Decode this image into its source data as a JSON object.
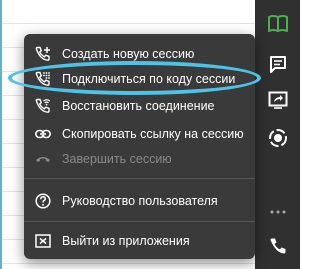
{
  "toolbar": {
    "buttons": [
      {
        "icon": "book-icon",
        "color": "#4caf50"
      },
      {
        "icon": "chat-icon",
        "color": "#ffffff"
      },
      {
        "icon": "screen-share-icon",
        "color": "#ffffff"
      },
      {
        "icon": "record-icon",
        "color": "#ffffff"
      },
      {
        "icon": "more-icon",
        "color": "#aaaaaa"
      },
      {
        "icon": "phone-icon",
        "color": "#ffffff"
      }
    ]
  },
  "menu": {
    "items": [
      {
        "label": "Создать новую сессию",
        "icon": "phone-add-icon",
        "enabled": true
      },
      {
        "label": "Подключиться по коду сессии",
        "icon": "phone-dial-icon",
        "enabled": true
      },
      {
        "label": "Восстановить соединение",
        "icon": "phone-wifi-icon",
        "enabled": true
      },
      {
        "label": "Скопировать ссылку на сессию",
        "icon": "link-icon",
        "enabled": true
      },
      {
        "label": "Завершить сессию",
        "icon": "hang-up-icon",
        "enabled": false
      },
      {
        "label": "Руководство пользователя",
        "icon": "help-icon",
        "enabled": true
      },
      {
        "label": "Выйти из приложения",
        "icon": "exit-icon",
        "enabled": true
      }
    ]
  },
  "colors": {
    "menu_bg": "#3a3a3a",
    "toolbar_bg": "#303030",
    "highlight": "#4dc3e6",
    "accent_green": "#4caf50"
  }
}
